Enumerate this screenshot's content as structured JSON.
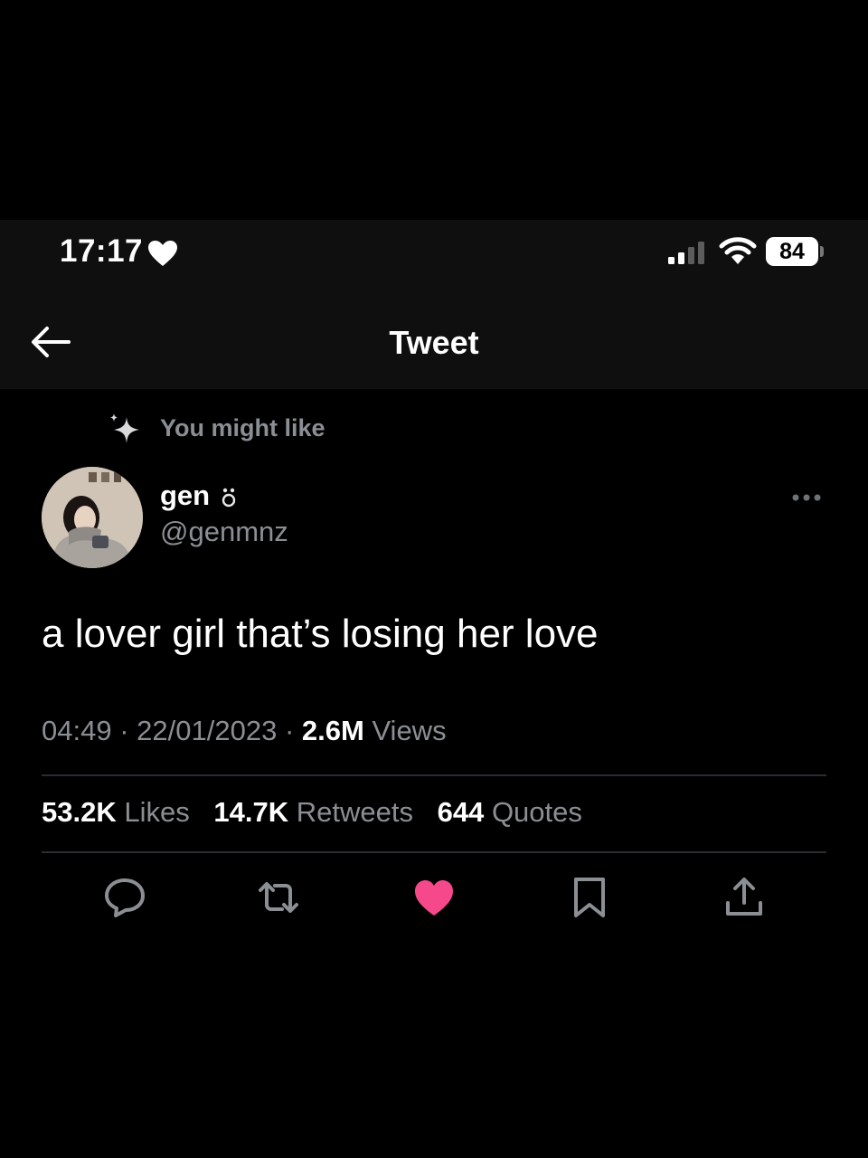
{
  "status_bar": {
    "time": "17:17",
    "battery": "84",
    "heart_icon": "heart-icon",
    "signal_icon": "signal-icon",
    "wifi_icon": "wifi-icon"
  },
  "header": {
    "title": "Tweet",
    "back_icon": "arrow-left-icon"
  },
  "suggestion": {
    "label": "You might like",
    "icon": "sparkle-icon"
  },
  "author": {
    "name": "gen",
    "name_emoji": "ʚ",
    "handle": "@genmnz"
  },
  "tweet": {
    "text": "a lover girl that’s losing her love",
    "time": "04:49",
    "date": "22/01/2023",
    "views_count": "2.6M",
    "views_label": "Views"
  },
  "stats": {
    "likes_count": "53.2K",
    "likes_label": "Likes",
    "retweets_count": "14.7K",
    "retweets_label": "Retweets",
    "quotes_count": "644",
    "quotes_label": "Quotes"
  },
  "actions": [
    "reply-icon",
    "retweet-icon",
    "like-icon",
    "bookmark-icon",
    "share-icon"
  ],
  "colors": {
    "background": "#000000",
    "text_primary": "#ffffff",
    "text_secondary": "#8b8f94",
    "like": "#f5498b",
    "divider": "#2a2c30"
  }
}
